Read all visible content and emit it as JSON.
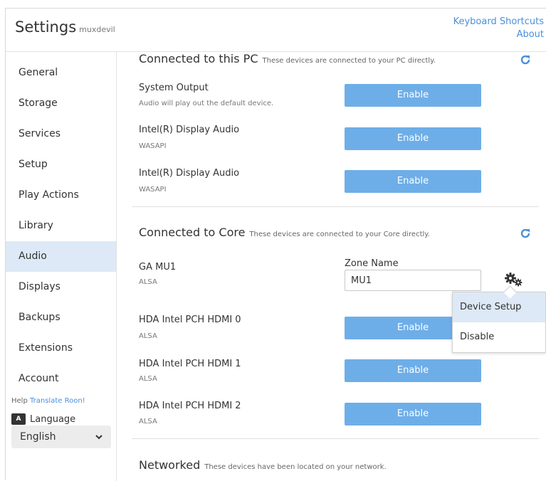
{
  "header": {
    "title": "Settings",
    "user": "muxdevil",
    "links": [
      "Keyboard Shortcuts",
      "About"
    ]
  },
  "sidebar": {
    "items": [
      {
        "label": "General"
      },
      {
        "label": "Storage"
      },
      {
        "label": "Services"
      },
      {
        "label": "Setup"
      },
      {
        "label": "Play Actions"
      },
      {
        "label": "Library"
      },
      {
        "label": "Audio",
        "active": true
      },
      {
        "label": "Displays"
      },
      {
        "label": "Backups"
      },
      {
        "label": "Extensions"
      },
      {
        "label": "Account"
      }
    ],
    "help_prefix": "Help",
    "help_link": "Translate Roon!",
    "language_label": "Language",
    "language_icon_text": "A",
    "language_value": "English"
  },
  "sections": {
    "pc": {
      "title": "Connected to this PC",
      "desc": "These devices are connected to your PC directly.",
      "devices": [
        {
          "name": "System Output",
          "sub": "Audio will play out the default device.",
          "button": "Enable"
        },
        {
          "name": "Intel(R) Display Audio",
          "sub": "WASAPI",
          "button": "Enable"
        },
        {
          "name": "Intel(R) Display Audio",
          "sub": "WASAPI",
          "button": "Enable"
        }
      ]
    },
    "core": {
      "title": "Connected to Core",
      "desc": "These devices are connected to your Core directly.",
      "zone_label": "Zone Name",
      "devices": [
        {
          "name": "GA MU1",
          "sub": "ALSA",
          "zone_name": "MU1"
        },
        {
          "name": "HDA Intel PCH HDMI 0",
          "sub": "ALSA",
          "button": "Enable"
        },
        {
          "name": "HDA Intel PCH HDMI 1",
          "sub": "ALSA",
          "button": "Enable"
        },
        {
          "name": "HDA Intel PCH HDMI 2",
          "sub": "ALSA",
          "button": "Enable"
        }
      ]
    },
    "networked": {
      "title": "Networked",
      "desc": "These devices have been located on your network."
    }
  },
  "dropdown": {
    "items": [
      "Device Setup",
      "Disable"
    ]
  },
  "colors": {
    "accent": "#4a90d9",
    "button": "#6eaee8",
    "active_bg": "#dde9f6"
  },
  "icons": {
    "refresh": "refresh-icon",
    "gear": "gear-icon",
    "chevron": "chevron-down-icon",
    "language": "language-icon"
  }
}
